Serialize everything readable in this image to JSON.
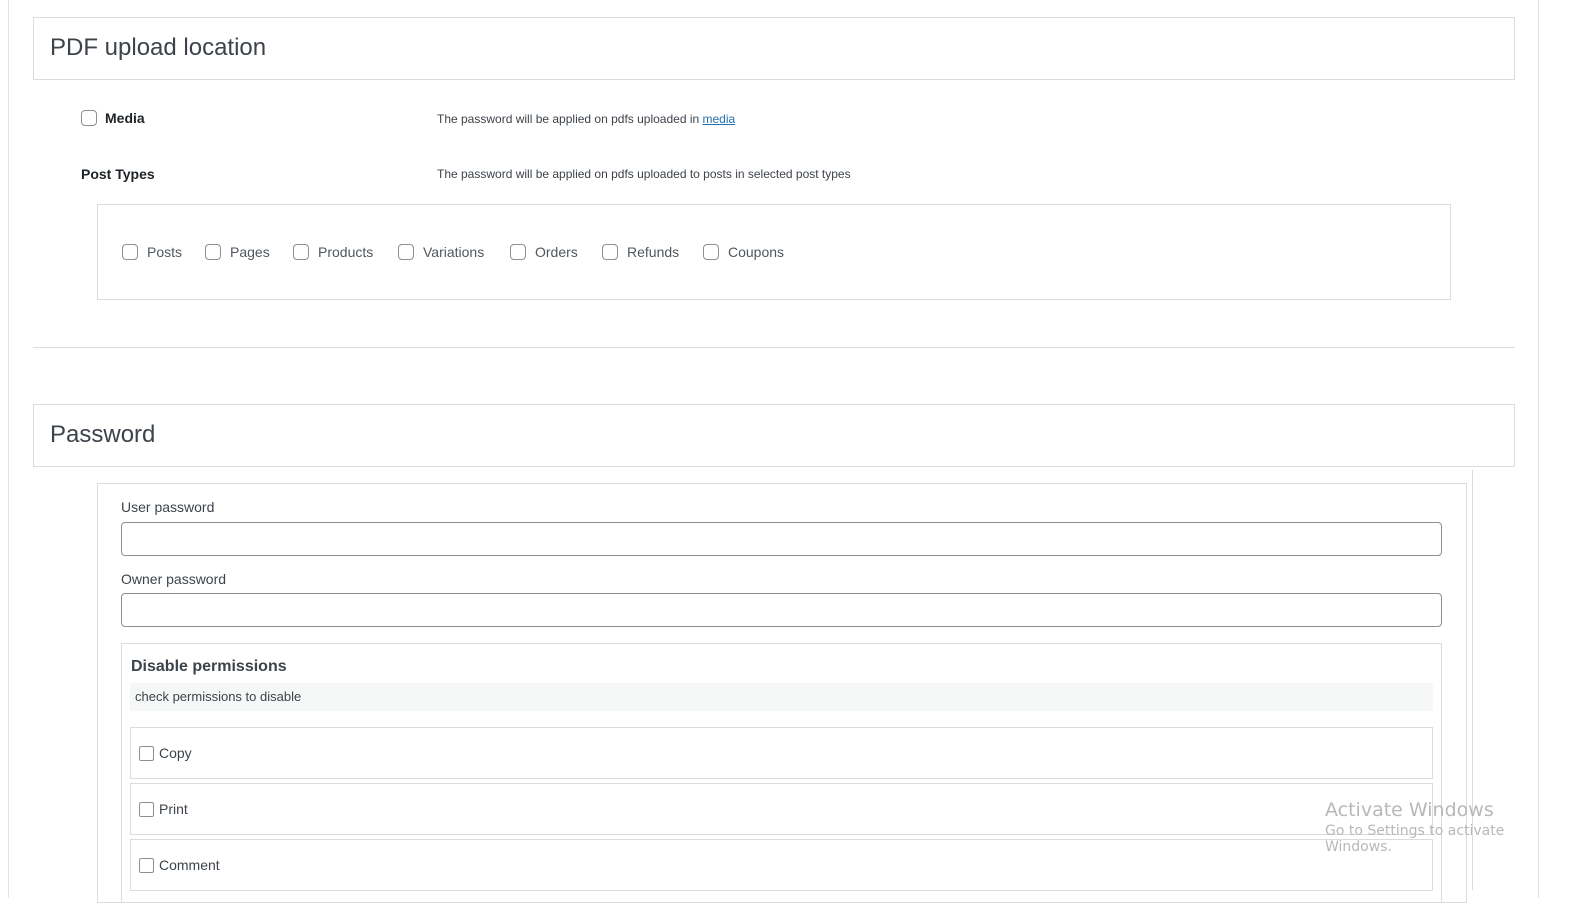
{
  "upload_section": {
    "title": "PDF upload location",
    "media_label": "Media",
    "media_desc": "The password will be applied on pdfs uploaded in ",
    "media_link": "media",
    "post_types_label": "Post Types",
    "post_types_desc": "The password will be applied on pdfs uploaded to posts in selected post types",
    "post_types": [
      "Posts",
      "Pages",
      "Products",
      "Variations",
      "Orders",
      "Refunds",
      "Coupons"
    ]
  },
  "password_section": {
    "title": "Password",
    "user_password_label": "User password",
    "user_password_value": "",
    "owner_password_label": "Owner password",
    "owner_password_value": "",
    "permissions_title": "Disable permissions",
    "permissions_hint": "check permissions to disable",
    "permissions": [
      "Copy",
      "Print",
      "Comment"
    ]
  },
  "watermark": {
    "line1": "Activate Windows",
    "line2": "Go to Settings to activate Windows."
  }
}
